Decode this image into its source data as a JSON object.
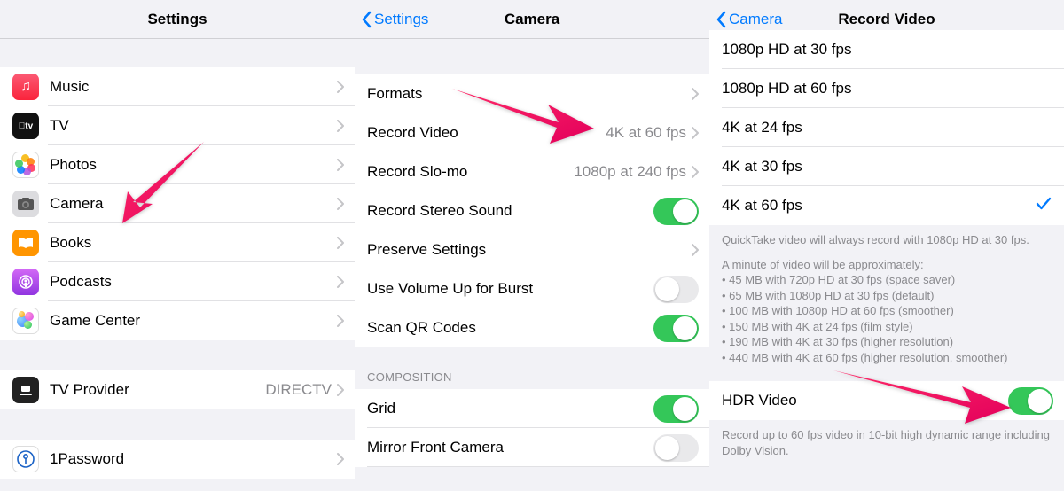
{
  "pane1": {
    "title": "Settings",
    "items": [
      {
        "label": "Music"
      },
      {
        "label": "TV"
      },
      {
        "label": "Photos"
      },
      {
        "label": "Camera"
      },
      {
        "label": "Books"
      },
      {
        "label": "Podcasts"
      },
      {
        "label": "Game Center"
      }
    ],
    "tv_provider_label": "TV Provider",
    "tv_provider_value": "DIRECTV",
    "onepassword_label": "1Password"
  },
  "pane2": {
    "back": "Settings",
    "title": "Camera",
    "rows": {
      "formats": "Formats",
      "record_video": "Record Video",
      "record_video_value": "4K at 60 fps",
      "record_slomo": "Record Slo-mo",
      "record_slomo_value": "1080p at 240 fps",
      "stereo": "Record Stereo Sound",
      "preserve": "Preserve Settings",
      "volume_burst": "Use Volume Up for Burst",
      "scan_qr": "Scan QR Codes"
    },
    "composition_header": "COMPOSITION",
    "grid": "Grid",
    "mirror": "Mirror Front Camera"
  },
  "pane3": {
    "back": "Camera",
    "title": "Record Video",
    "options": [
      "1080p HD at 30 fps",
      "1080p HD at 60 fps",
      "4K at 24 fps",
      "4K at 30 fps",
      "4K at 60 fps"
    ],
    "selected_index": 4,
    "quicktake_note": "QuickTake video will always record with 1080p HD at 30 fps.",
    "approx_header": "A minute of video will be approximately:",
    "approx_lines": [
      "45 MB with 720p HD at 30 fps (space saver)",
      "65 MB with 1080p HD at 30 fps (default)",
      "100 MB with 1080p HD at 60 fps (smoother)",
      "150 MB with 4K at 24 fps (film style)",
      "190 MB with 4K at 30 fps (higher resolution)",
      "440 MB with 4K at 60 fps (higher resolution, smoother)"
    ],
    "hdr_label": "HDR Video",
    "hdr_footer": "Record up to 60 fps video in 10-bit high dynamic range including Dolby Vision."
  }
}
